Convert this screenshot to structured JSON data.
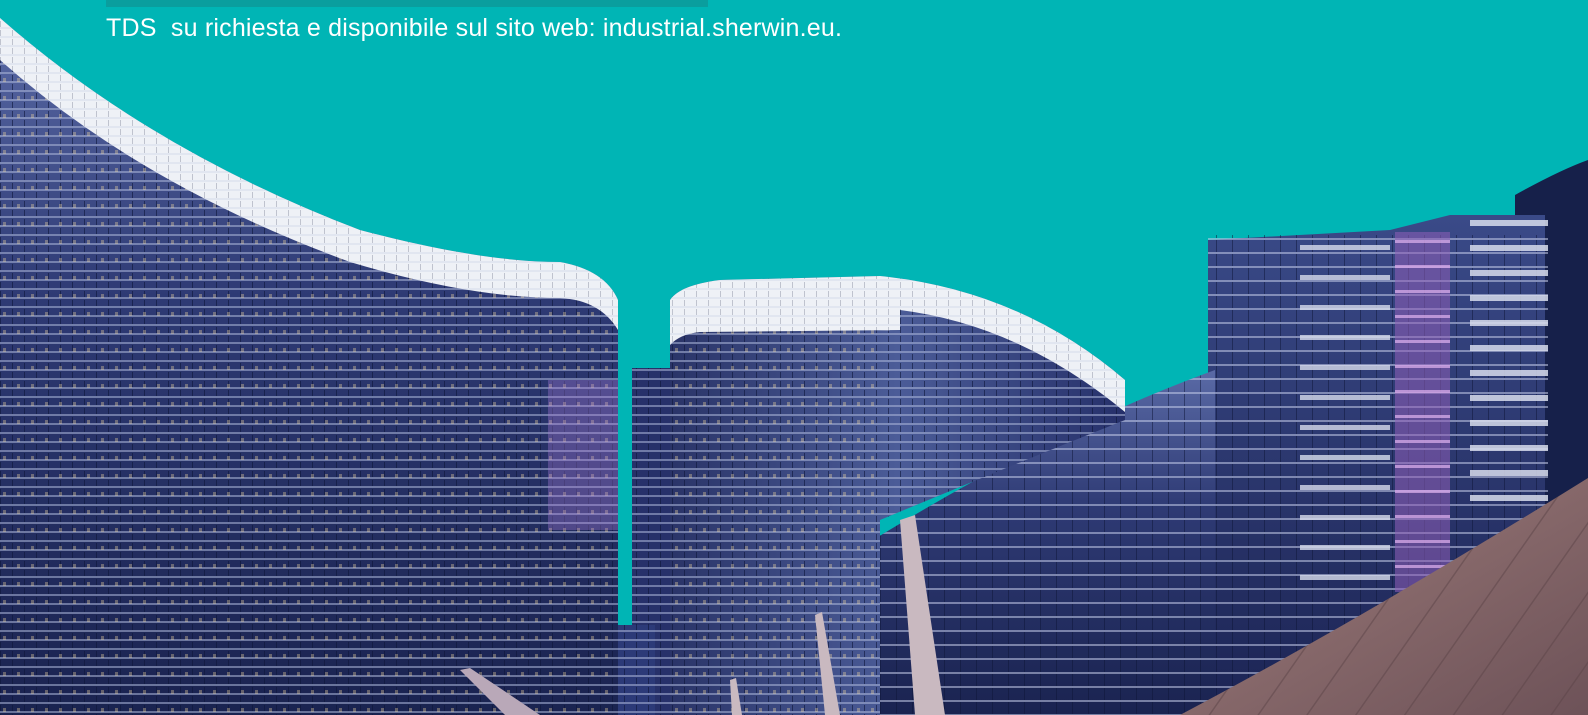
{
  "caption": {
    "text": "TDS  su richiesta e disponibile sul sito web: industrial.sherwin.eu."
  },
  "photo": {
    "subject": "night-time-skyline-of-curved-glass-hotel-towers",
    "colors": {
      "sky": "#00b5b5",
      "facade_dark": "#1c2553",
      "facade_mid": "#3a4a86",
      "crown_light": "#f2f4f7",
      "accent_purple": "#b67bd6",
      "roof_bronze": "#8a6a6a"
    }
  }
}
